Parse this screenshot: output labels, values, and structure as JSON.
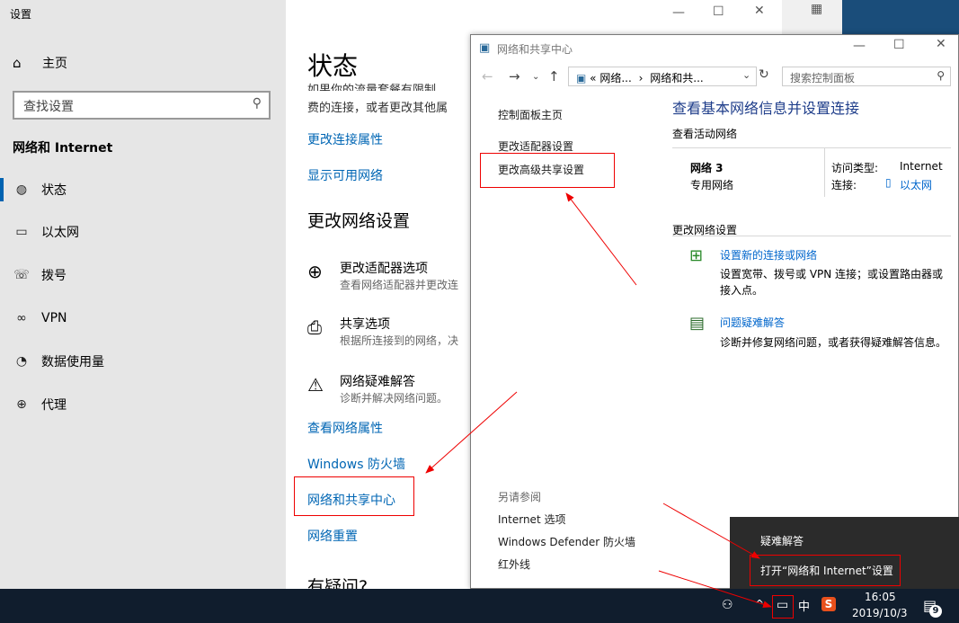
{
  "settings": {
    "title": "设置",
    "home": "主页",
    "search_placeholder": "查找设置",
    "section": "网络和 Internet",
    "nav": [
      "状态",
      "以太网",
      "拨号",
      "VPN",
      "数据使用量",
      "代理"
    ],
    "main": {
      "title": "状态",
      "faded_line": "如果你的流量套餐有限制，",
      "line2": "费的连接，或者更改其他属",
      "link_change_conn": "更改连接属性",
      "link_show_networks": "显示可用网络",
      "h_change": "更改网络设置",
      "options": [
        {
          "title": "更改适配器选项",
          "desc": "查看网络适配器并更改连"
        },
        {
          "title": "共享选项",
          "desc": "根据所连接到的网络，决"
        },
        {
          "title": "网络疑难解答",
          "desc": "诊断并解决网络问题。"
        }
      ],
      "link_props": "查看网络属性",
      "link_firewall": "Windows 防火墙",
      "link_nsc": "网络和共享中心",
      "link_reset": "网络重置",
      "cut_heading": "有疑问?"
    }
  },
  "nsc": {
    "title": "网络和共享中心",
    "addr_1": "«  网络...",
    "addr_2": "网络和共...",
    "search_placeholder": "搜索控制面板",
    "left_links": [
      "控制面板主页",
      "更改适配器设置",
      "更改高级共享设置"
    ],
    "see_also": "另请参阅",
    "see_links": [
      "Internet 选项",
      "Windows Defender 防火墙",
      "红外线"
    ],
    "heading": "查看基本网络信息并设置连接",
    "active_label": "查看活动网络",
    "network_name": "网络 3",
    "network_type": "专用网络",
    "access_type_label": "访问类型:",
    "access_type_value": "Internet",
    "conn_label": "连接:",
    "conn_value": "以太网",
    "change_label": "更改网络设置",
    "new_conn_title": "设置新的连接或网络",
    "new_conn_desc1": "设置宽带、拨号或 VPN 连接；或设置路由器或",
    "new_conn_desc2": "接入点。",
    "trouble_title": "问题疑难解答",
    "trouble_desc": "诊断并修复网络问题，或者获得疑难解答信息。"
  },
  "popup": {
    "item1": "疑难解答",
    "item2": "打开“网络和 Internet”设置"
  },
  "taskbar": {
    "time": "16:05",
    "date": "2019/10/3",
    "ime": "中",
    "notif_count": "9"
  }
}
